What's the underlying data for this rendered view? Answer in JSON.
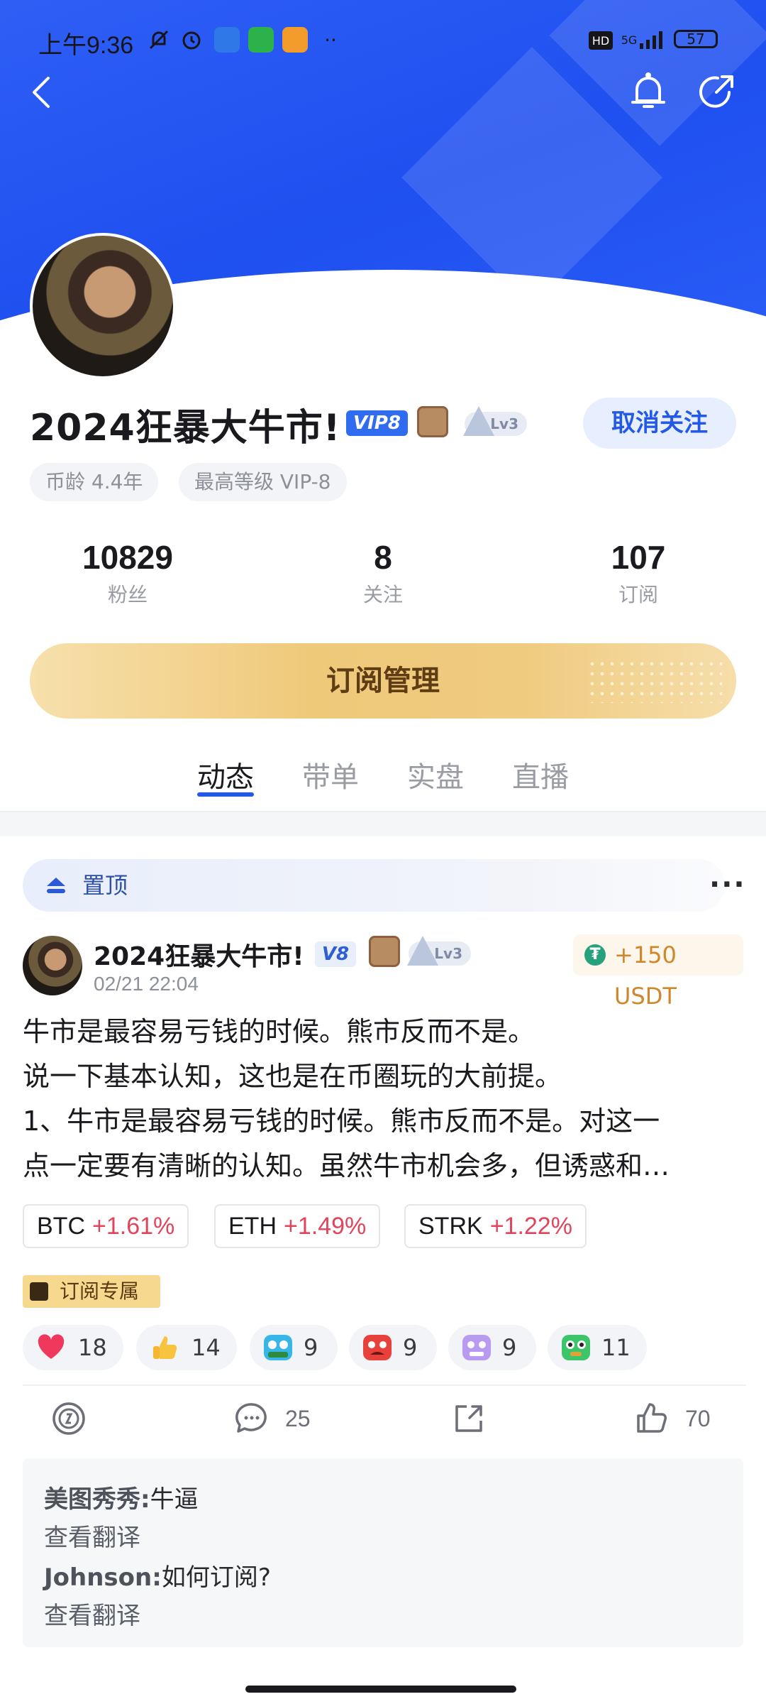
{
  "status_bar": {
    "time": "上午9:36",
    "network": "5G",
    "battery": "57"
  },
  "profile": {
    "name": "2024狂暴大牛市!",
    "vip_badge": "VIP8",
    "level_badge": "Lv3",
    "unfollow_label": "取消关注",
    "chips": [
      "币龄 4.4年",
      "最高等级 VIP-8"
    ],
    "stats": [
      {
        "value": "10829",
        "label": "粉丝"
      },
      {
        "value": "8",
        "label": "关注"
      },
      {
        "value": "107",
        "label": "订阅"
      }
    ],
    "subscribe_manage_label": "订阅管理"
  },
  "tabs": [
    {
      "label": "动态",
      "active": true
    },
    {
      "label": "带单",
      "active": false
    },
    {
      "label": "实盘",
      "active": false
    },
    {
      "label": "直播",
      "active": false
    }
  ],
  "post": {
    "pinned_label": "置顶",
    "author": "2024狂暴大牛市!",
    "vip_short": "V8",
    "level_badge": "Lv3",
    "date": "02/21 22:04",
    "reward": "+150 USDT",
    "lines": [
      "牛市是最容易亏钱的时候。熊市反而不是。",
      "说一下基本认知，这也是在币圈玩的大前提。",
      "1、牛市是最容易亏钱的时候。熊市反而不是。对这一",
      "点一定要有清晰的认知。虽然牛市机会多，但诱惑和…"
    ],
    "coins": [
      {
        "symbol": "BTC",
        "change": "+1.61%"
      },
      {
        "symbol": "ETH",
        "change": "+1.49%"
      },
      {
        "symbol": "STRK",
        "change": "+1.22%"
      }
    ],
    "exclusive_label": "订阅专属",
    "reactions": [
      {
        "icon": "heart-icon",
        "count": "18"
      },
      {
        "icon": "thumbs-up-emoji-icon",
        "count": "14"
      },
      {
        "icon": "hodl-emoji-icon",
        "count": "9"
      },
      {
        "icon": "angry-emoji-icon",
        "count": "9"
      },
      {
        "icon": "purple-emoji-icon",
        "count": "9"
      },
      {
        "icon": "green-emoji-icon",
        "count": "11"
      }
    ],
    "actions": {
      "comments": "25",
      "likes": "70"
    },
    "comments": [
      {
        "user": "美图秀秀:",
        "text": "牛逼",
        "translate": "查看翻译"
      },
      {
        "user": "Johnson:",
        "text": "如何订阅?",
        "translate": "查看翻译"
      }
    ]
  },
  "colors": {
    "brand_blue": "#2359e6",
    "gain_red": "#e0455b",
    "gold": "#efc97a"
  }
}
